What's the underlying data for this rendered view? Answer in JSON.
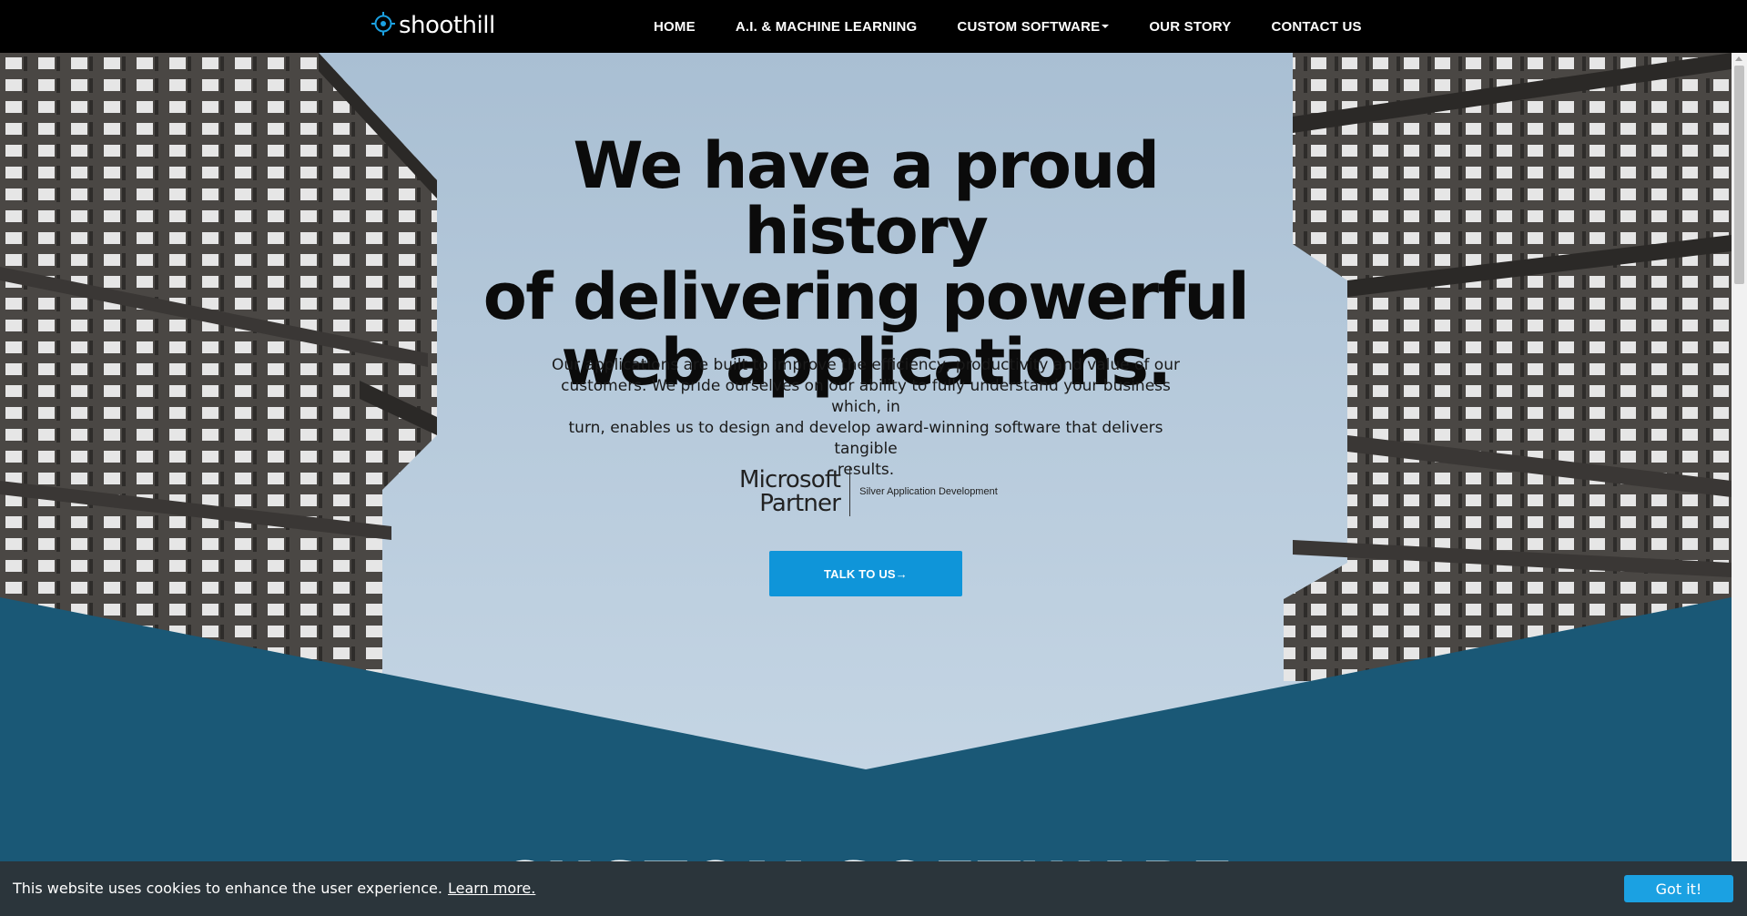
{
  "nav": {
    "logo_text": "shoothill",
    "items": [
      {
        "label": "HOME"
      },
      {
        "label": "A.I. & MACHINE LEARNING"
      },
      {
        "label": "CUSTOM SOFTWARE"
      },
      {
        "label": "OUR STORY"
      },
      {
        "label": "CONTACT US"
      }
    ]
  },
  "hero": {
    "title_lines": [
      "We have a proud history",
      "of delivering powerful",
      "web applications."
    ],
    "paragraph_lines": [
      "Our applications are built to improve the efficiency, productivity and value of our",
      "customers. We pride ourselves on our ability to fully understand your business which, in",
      "turn, enables us to design and develop award-winning software that delivers tangible",
      "results."
    ],
    "partner": {
      "line1": "Microsoft",
      "line2": "Partner",
      "tier": "Silver Application Development"
    },
    "cta_label": "TALK TO US→"
  },
  "section": {
    "heading": "CUSTOM SOFTWARE"
  },
  "cookie": {
    "message": "This website uses cookies to enhance the user experience.",
    "link": "Learn more.",
    "button": "Got it!"
  },
  "colors": {
    "nav_bg": "#000000",
    "section_blue": "#1a5876",
    "cta_blue": "#0f95d9",
    "cookie_bg": "#2b353b",
    "cookie_button": "#1ba1e2"
  }
}
